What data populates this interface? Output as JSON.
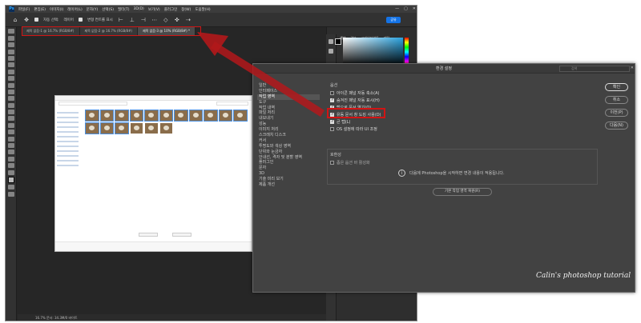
{
  "photoshop": {
    "menu": [
      "파일(F)",
      "편집(E)",
      "이미지(I)",
      "레이어(L)",
      "문자(Y)",
      "선택(S)",
      "필터(T)",
      "3D(D)",
      "보기(V)",
      "플러그인",
      "창(W)",
      "도움말(H)"
    ],
    "options": {
      "auto_select_label": "자동 선택:",
      "layer_label": "레이어",
      "transform_label": "변형 컨트롤 표시",
      "share_label": "공유"
    },
    "tabs": [
      "제목 없음-1 @ 16.7% (RGB/8#)",
      "제목 없음-2 @ 16.7% (RGB/8#)",
      "제목 없음-3 @ 10% (RGB/8#) *"
    ],
    "status": "16.7% 문서: 34.3M/0 바이트",
    "panel_tabs": [
      "색상",
      "견본",
      "그레이디언트",
      "패턴"
    ]
  },
  "explorer": {
    "thumb_count": 17
  },
  "dialog": {
    "title": "환경 설정",
    "search_placeholder": "검색",
    "categories": [
      "일반",
      "인터페이스",
      "작업 영역",
      "도구",
      "작업 내역",
      "파일 처리",
      "내보내기",
      "성능",
      "이미지 처리",
      "스크래치 디스크",
      "커서",
      "투명도와 색상 영역",
      "단위와 눈금자",
      "안내선, 격자 및 분할 영역",
      "플러그인",
      "문자",
      "3D",
      "기술 미리 보기",
      "제품 개선"
    ],
    "selected_category": "작업 영역",
    "section_options": "옵션",
    "options": [
      {
        "label": "아이콘 패널 자동 축소(A)",
        "checked": false
      },
      {
        "label": "숨겨진 패널 자동 표시(H)",
        "checked": true
      },
      {
        "label": "탭으로 문서 열기(O)",
        "checked": true
      },
      {
        "label": "유동 문서 창 도킹 사용(D)",
        "checked": true
      },
      {
        "label": "큰 탭(L)",
        "checked": true
      },
      {
        "label": "OS 설정에 따라 UI 조정",
        "checked": false
      }
    ],
    "section_legacy": "호환성",
    "legacy_option": "좁은 옵션 바 활성화",
    "info_text": "다음에 Photoshop을 시작하면 변경 내용이 적용됩니다.",
    "reset_label": "기본 작업 영역 복원(R)",
    "buttons": {
      "ok": "확인",
      "cancel": "취소",
      "prev": "이전(P)",
      "next": "다음(N)"
    }
  },
  "watermark": "Calin's photoshop tutorial",
  "colors": {
    "highlight": "#d21414",
    "arrow": "#b3181b",
    "ps_bg": "#262626",
    "dialog_bg": "#424242",
    "accent": "#1473e6"
  }
}
